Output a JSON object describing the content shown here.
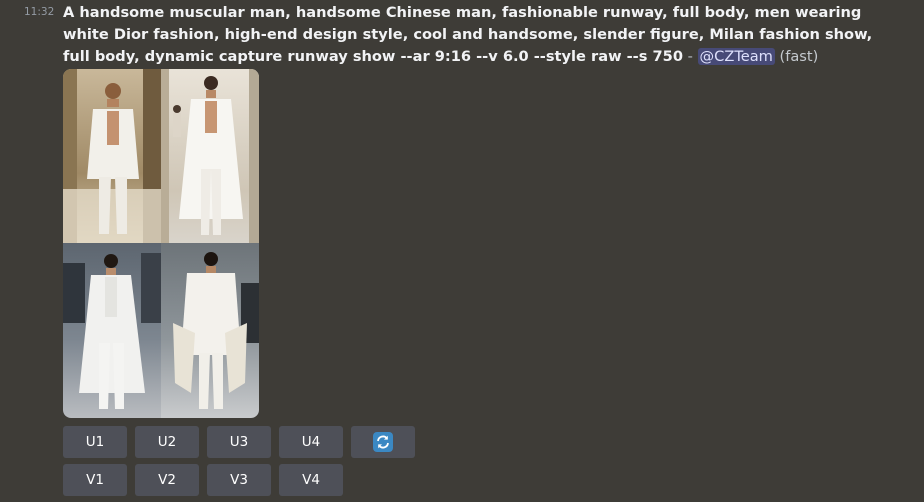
{
  "message": {
    "timestamp": "11:32",
    "prompt_text": "A handsome muscular man, handsome Chinese man, fashionable runway, full body, men wearing white Dior fashion, high-end design style, cool and handsome, slender figure, Milan fashion show, full body, dynamic capture runway show --ar 9:16 --v 6.0 --style raw --s 750",
    "separator": " - ",
    "mention": "@CZTeam",
    "mode": " (fast)"
  },
  "images": [
    {
      "label": "top-left",
      "alt": "man in white open coat on runway"
    },
    {
      "label": "top-right",
      "alt": "man in long white coat on runway"
    },
    {
      "label": "bottom-left",
      "alt": "man in white suit and long coat"
    },
    {
      "label": "bottom-right",
      "alt": "man in white double-breasted suit with fur coat"
    }
  ],
  "buttons": {
    "upscale": [
      "U1",
      "U2",
      "U3",
      "U4"
    ],
    "variation": [
      "V1",
      "V2",
      "V3",
      "V4"
    ],
    "reroll_icon": "refresh-icon"
  },
  "colors": {
    "background": "#3e3c37",
    "button": "#4e5058",
    "mention_bg": "#5865f2",
    "reroll_icon_bg": "#3b88c3"
  }
}
